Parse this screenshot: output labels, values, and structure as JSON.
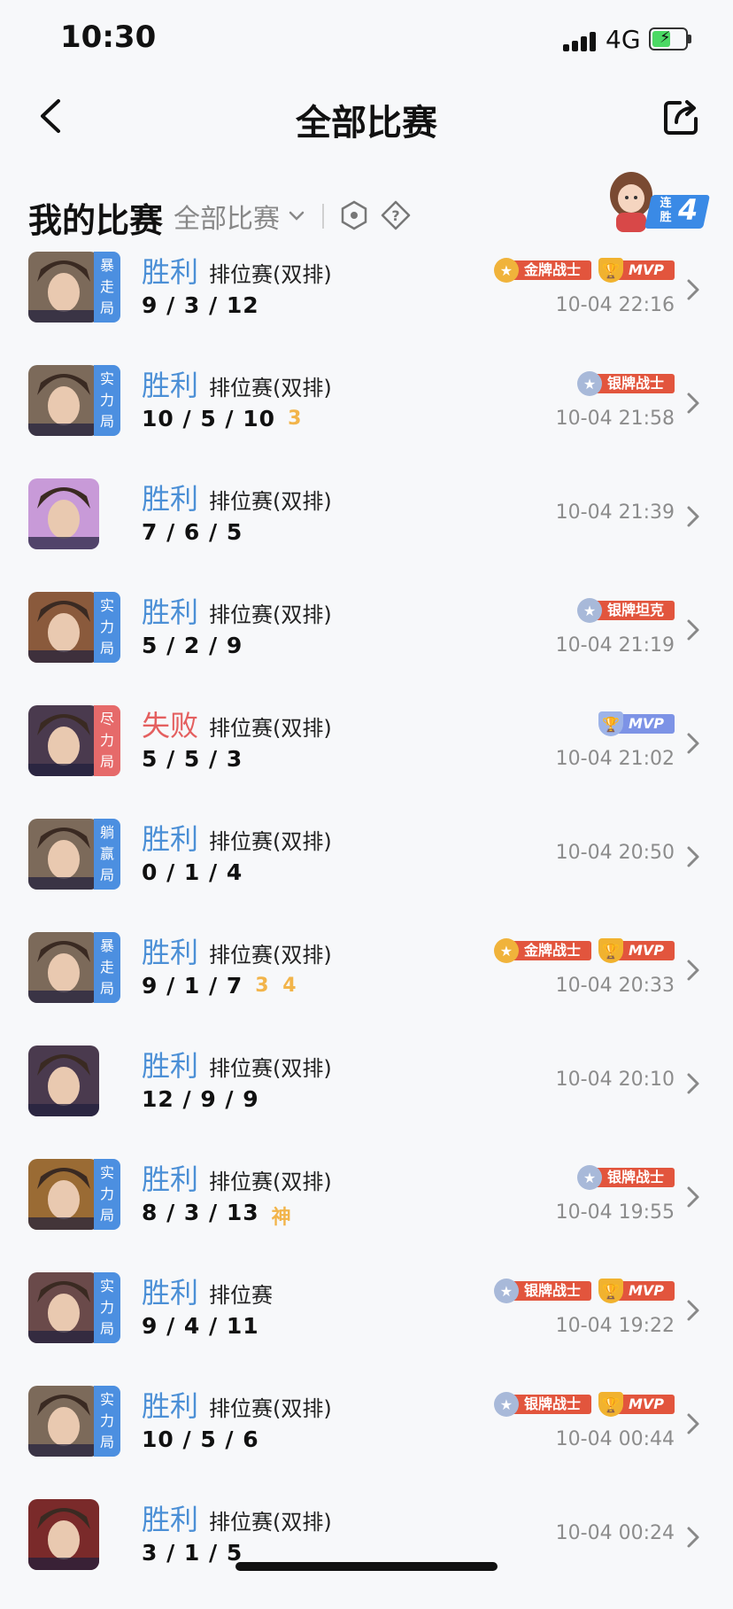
{
  "status_bar": {
    "time": "10:30",
    "network": "4G"
  },
  "nav": {
    "title": "全部比赛"
  },
  "filter": {
    "section_title": "我的比赛",
    "dropdown_label": "全部比赛",
    "streak_small": "连胜",
    "streak_count": "4"
  },
  "matches": [
    {
      "result": "胜利",
      "outcome": "win",
      "mode": "排位赛(双排)",
      "kda": "9 / 3 / 12",
      "extras": "",
      "time": "10-04 22:16",
      "tag": "暴走局",
      "tag_color": "blue",
      "badges": [
        {
          "type": "gold",
          "label": "金牌战士"
        },
        {
          "type": "mvp",
          "label": "MVP"
        }
      ],
      "hero_color": "#7c6a5a"
    },
    {
      "result": "胜利",
      "outcome": "win",
      "mode": "排位赛(双排)",
      "kda": "10 / 5 / 10",
      "extras": "3",
      "time": "10-04 21:58",
      "tag": "实力局",
      "tag_color": "blue",
      "badges": [
        {
          "type": "silver",
          "label": "银牌战士"
        }
      ],
      "hero_color": "#7c6a5a"
    },
    {
      "result": "胜利",
      "outcome": "win",
      "mode": "排位赛(双排)",
      "kda": "7 / 6 / 5",
      "extras": "",
      "time": "10-04 21:39",
      "tag": "",
      "tag_color": "blue",
      "badges": [],
      "hero_color": "#c89ad8"
    },
    {
      "result": "胜利",
      "outcome": "win",
      "mode": "排位赛(双排)",
      "kda": "5 / 2 / 9",
      "extras": "",
      "time": "10-04 21:19",
      "tag": "实力局",
      "tag_color": "blue",
      "badges": [
        {
          "type": "silver",
          "label": "银牌坦克"
        }
      ],
      "hero_color": "#8a5a3c"
    },
    {
      "result": "失败",
      "outcome": "lose",
      "mode": "排位赛(双排)",
      "kda": "5 / 5 / 3",
      "extras": "",
      "time": "10-04 21:02",
      "tag": "尽力局",
      "tag_color": "red",
      "badges": [
        {
          "type": "mvp-silver",
          "label": "MVP"
        }
      ],
      "hero_color": "#4a3a4e"
    },
    {
      "result": "胜利",
      "outcome": "win",
      "mode": "排位赛(双排)",
      "kda": "0 / 1 / 4",
      "extras": "",
      "time": "10-04 20:50",
      "tag": "躺赢局",
      "tag_color": "blue",
      "badges": [],
      "hero_color": "#7c6a5a"
    },
    {
      "result": "胜利",
      "outcome": "win",
      "mode": "排位赛(双排)",
      "kda": "9 / 1 / 7",
      "extras": "3 4",
      "time": "10-04 20:33",
      "tag": "暴走局",
      "tag_color": "blue",
      "badges": [
        {
          "type": "gold",
          "label": "金牌战士"
        },
        {
          "type": "mvp",
          "label": "MVP"
        }
      ],
      "hero_color": "#7c6a5a"
    },
    {
      "result": "胜利",
      "outcome": "win",
      "mode": "排位赛(双排)",
      "kda": "12 / 9 / 9",
      "extras": "",
      "time": "10-04 20:10",
      "tag": "",
      "tag_color": "blue",
      "badges": [],
      "hero_color": "#4a3a4e"
    },
    {
      "result": "胜利",
      "outcome": "win",
      "mode": "排位赛(双排)",
      "kda": "8 / 3 / 13",
      "extras": "神",
      "time": "10-04 19:55",
      "tag": "实力局",
      "tag_color": "blue",
      "badges": [
        {
          "type": "silver",
          "label": "银牌战士"
        }
      ],
      "hero_color": "#9a6b34"
    },
    {
      "result": "胜利",
      "outcome": "win",
      "mode": "排位赛",
      "kda": "9 / 4 / 11",
      "extras": "",
      "time": "10-04 19:22",
      "tag": "实力局",
      "tag_color": "blue",
      "badges": [
        {
          "type": "silver",
          "label": "银牌战士"
        },
        {
          "type": "mvp",
          "label": "MVP"
        }
      ],
      "hero_color": "#6a4a4a"
    },
    {
      "result": "胜利",
      "outcome": "win",
      "mode": "排位赛(双排)",
      "kda": "10 / 5 / 6",
      "extras": "",
      "time": "10-04 00:44",
      "tag": "实力局",
      "tag_color": "blue",
      "badges": [
        {
          "type": "silver",
          "label": "银牌战士"
        },
        {
          "type": "mvp",
          "label": "MVP"
        }
      ],
      "hero_color": "#7c6a5a"
    },
    {
      "result": "胜利",
      "outcome": "win",
      "mode": "排位赛(双排)",
      "kda": "3 / 1 / 5",
      "extras": "",
      "time": "10-04 00:24",
      "tag": "",
      "tag_color": "blue",
      "badges": [],
      "hero_color": "#7a2a2a"
    }
  ]
}
